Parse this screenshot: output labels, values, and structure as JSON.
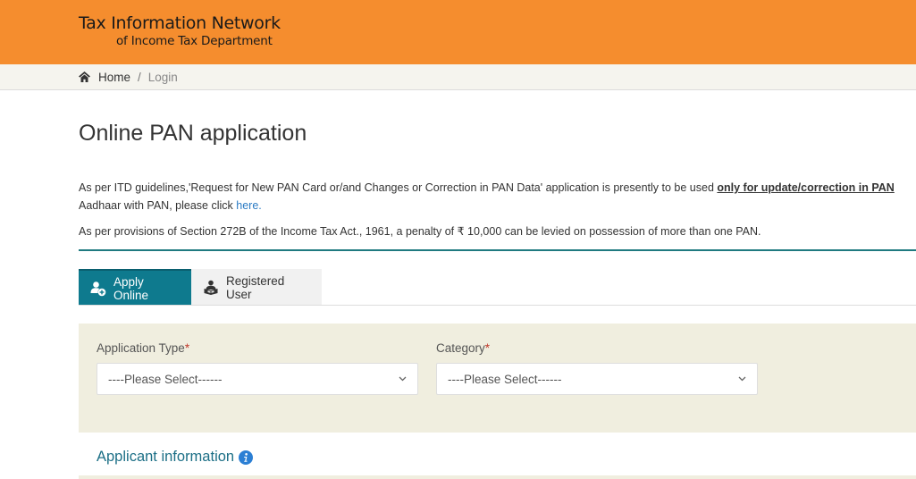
{
  "header": {
    "brand_line1": "Tax Information Network",
    "brand_line2": "of Income Tax Department",
    "color": "#f58d2e"
  },
  "breadcrumb": {
    "icon": "home-icon",
    "home": "Home",
    "separator": "/",
    "current": "Login"
  },
  "page": {
    "title": "Online PAN application"
  },
  "notice": {
    "line1_prefix": "As per ITD guidelines,'Request for New PAN Card or/and Changes or Correction in PAN Data' application is presently to be used ",
    "line1_emphasis": "only for update/correction in PAN",
    "line2_prefix": "Aadhaar with PAN, please click ",
    "line2_link": "here.",
    "penalty": "As per provisions of Section 272B of the Income Tax Act., 1961, a penalty of ₹ 10,000 can be levied on possession of more than one PAN."
  },
  "tabs": [
    {
      "label": "Apply Online",
      "icon": "user-plus-icon",
      "active": true
    },
    {
      "label": "Registered User",
      "icon": "user-reading-icon",
      "active": false
    }
  ],
  "form": {
    "application_type": {
      "label": "Application Type",
      "required_mark": "*",
      "value": "----Please Select------"
    },
    "category": {
      "label": "Category",
      "required_mark": "*",
      "value": "----Please Select------"
    }
  },
  "applicant_section": {
    "title": "Applicant information",
    "icon": "info-icon"
  },
  "colors": {
    "accent_teal": "#0e7a8e",
    "panel_bg": "#f0eedf",
    "link": "#2b7bc4",
    "required": "#c0392b"
  }
}
